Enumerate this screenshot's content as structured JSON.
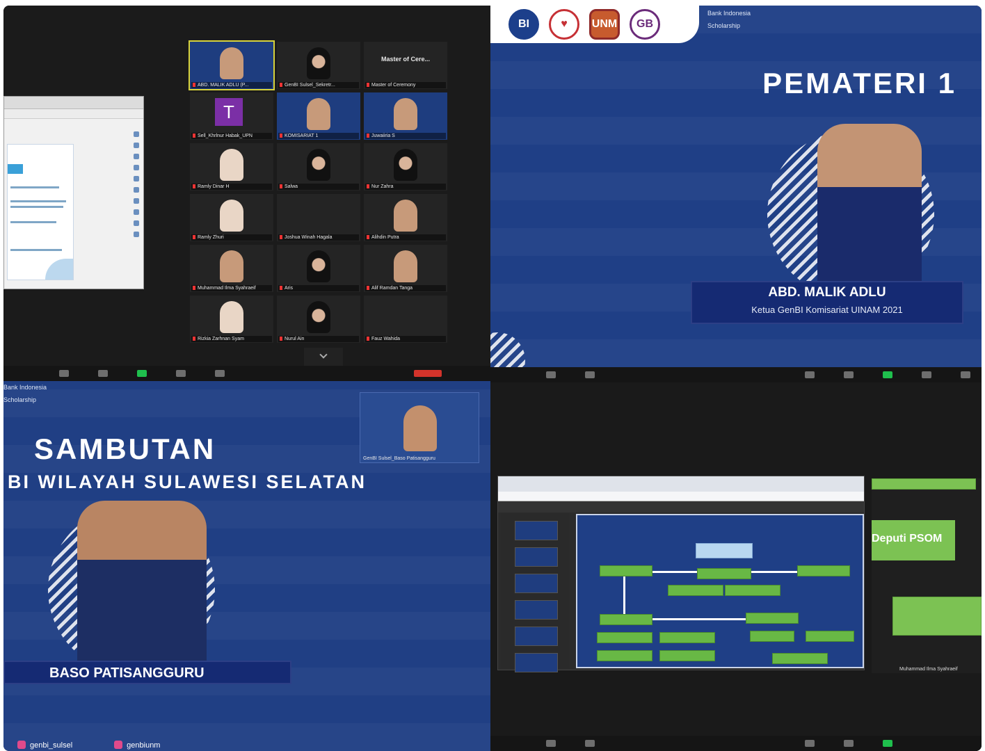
{
  "top_left": {
    "participants": [
      {
        "name": "ABD. MALIK ADLU (P...",
        "type": "slide",
        "active": true
      },
      {
        "name": "GenBI Sulsel_Sekretr...",
        "type": "hijab"
      },
      {
        "name": "Master of Ceremony",
        "type": "card",
        "card_text": "Master of Cere..."
      },
      {
        "name": "Sell_Khrlnur Habak_UPN",
        "type": "avatar",
        "letter": "T"
      },
      {
        "name": "KOMISARIAT 1",
        "type": "slide"
      },
      {
        "name": "Juwaiiria S",
        "type": "slide"
      },
      {
        "name": "Ramly Dinar H",
        "type": "light"
      },
      {
        "name": "Salwa",
        "type": "hijab"
      },
      {
        "name": "Nur Zahra",
        "type": "hijab"
      },
      {
        "name": "Ramly Zhuri",
        "type": "light"
      },
      {
        "name": "Joshua Winah Hagala",
        "type": "dark"
      },
      {
        "name": "Alihdin Putra",
        "type": "face"
      },
      {
        "name": "Muhammad Ilma Syahraeif",
        "type": "face"
      },
      {
        "name": "Aris",
        "type": "hijab"
      },
      {
        "name": "Alif Ramdan Tanga",
        "type": "face"
      },
      {
        "name": "Rizkia Zarhnan Syam",
        "type": "light"
      },
      {
        "name": "Nurul Ain",
        "type": "hijab"
      },
      {
        "name": "Fauz Wahida",
        "type": "dark"
      }
    ]
  },
  "top_right": {
    "logos": [
      "BI",
      "♥",
      "UNM",
      "GB"
    ],
    "scholarship_lines": [
      "Bank Indonesia",
      "Scholarship"
    ],
    "title": "PEMATERI 1",
    "speaker_name": "ABD. MALIK ADLU",
    "speaker_role": "Ketua GenBI Komisariat UINAM 2021"
  },
  "bottom_left": {
    "scholarship_lines": [
      "Bank Indonesia",
      "Scholarship"
    ],
    "title": "SAMBUTAN",
    "subtitle": "BI WILAYAH SULAWESI SELATAN",
    "camera_name": "GenBI Sulsel_Baso Patisangguru",
    "speaker_name": "BASO PATISANGGURU",
    "socials": [
      "genbi_sulsel",
      "genbiunm"
    ]
  },
  "bottom_right": {
    "side_label": "Deputi PSOM",
    "cam_name": "Muhammad Ilma Syahraeif"
  },
  "colors": {
    "slide_blue": "#1f3f86",
    "name_bar": "#152a73",
    "org_green": "#68b845",
    "zoom_green": "#1fbf4d",
    "active_border": "#d8d33a"
  }
}
